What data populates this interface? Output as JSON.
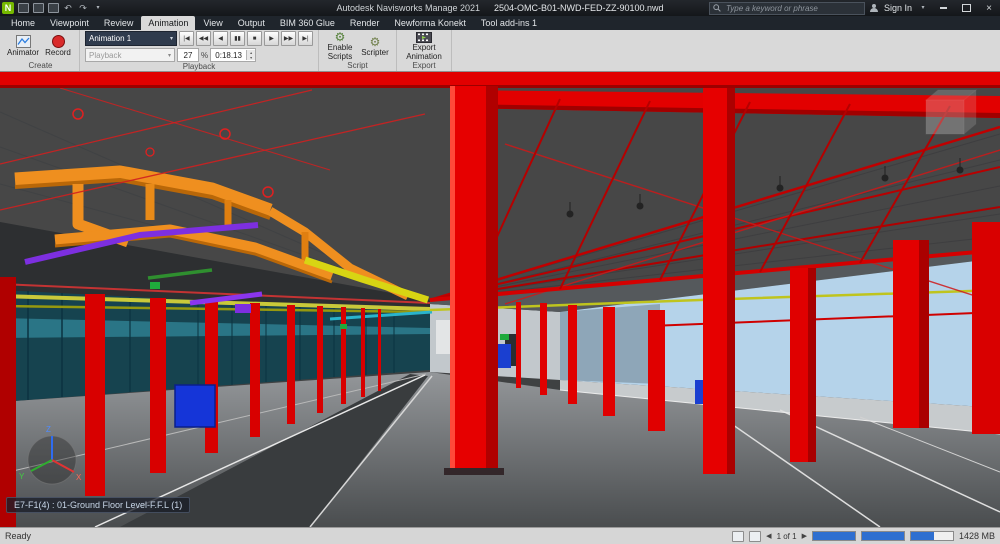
{
  "colors": {
    "structure_red": "#e10000",
    "duct_orange": "#ef8f1f",
    "conduit_purple": "#7d2fe0",
    "pipe_yellow": "#c9c93a",
    "sky_blue": "#b5d3ea",
    "navisworks_green": "#76b900",
    "ribbon_gray": "#d9d9d9"
  },
  "titlebar": {
    "logo_letter": "N",
    "app_name": "Autodesk Navisworks Manage 2021",
    "doc_name": "2504-OMC-B01-NWD-FED-ZZ-90100.nwd",
    "search_placeholder": "Type a keyword or phrase",
    "sign_in_label": "Sign In",
    "undo_glyph": "↶",
    "redo_glyph": "↷",
    "caret_glyph": "▾",
    "close_glyph": "×"
  },
  "tabs": {
    "items": [
      {
        "label": "Home"
      },
      {
        "label": "Viewpoint"
      },
      {
        "label": "Review"
      },
      {
        "label": "Animation"
      },
      {
        "label": "View"
      },
      {
        "label": "Output"
      },
      {
        "label": "BIM 360 Glue"
      },
      {
        "label": "Render"
      },
      {
        "label": "Newforma Konekt"
      },
      {
        "label": "Tool add-ins 1"
      }
    ]
  },
  "ribbon": {
    "create": {
      "group_label": "Create",
      "animator_label": "Animator",
      "record_label": "Record"
    },
    "playback": {
      "group_label": "Playback",
      "animation_name": "Animation 1",
      "caret_glyph": "▾",
      "buttons": [
        {
          "name": "go-to-start",
          "glyph": "|◀"
        },
        {
          "name": "step-back",
          "glyph": "◀◀"
        },
        {
          "name": "play-reverse",
          "glyph": "◀"
        },
        {
          "name": "pause",
          "glyph": "▮▮"
        },
        {
          "name": "stop",
          "glyph": "■"
        },
        {
          "name": "play",
          "glyph": "▶"
        },
        {
          "name": "step-forward",
          "glyph": "▶▶"
        },
        {
          "name": "go-to-end",
          "glyph": "▶|"
        }
      ],
      "position_label": "Playback",
      "frame_value": "27",
      "percent_glyph": "%",
      "time_value": "0:18.13",
      "spin_up": "▴",
      "spin_down": "▾"
    },
    "script": {
      "group_label": "Script",
      "gear_glyph": "⚙",
      "enable_line1": "Enable",
      "enable_line2": "Scripts",
      "scripter_label": "Scripter"
    },
    "export": {
      "group_label": "Export",
      "export_line1": "Export",
      "export_line2": "Animation"
    }
  },
  "viewport": {
    "selection_label": "E7-F1(4) : 01-Ground Floor Level-F.F.L (1)",
    "axis": {
      "x": "X",
      "y": "Y",
      "z": "Z"
    }
  },
  "statusbar": {
    "ready_label": "Ready",
    "nav_prev": "◀",
    "nav_next": "▶",
    "page_label": "1 of 1",
    "memory_label": "1428 MB",
    "progress": [
      {
        "name": "pencil",
        "percent": 100
      },
      {
        "name": "disk",
        "percent": 100
      },
      {
        "name": "web",
        "percent": 55
      }
    ]
  }
}
